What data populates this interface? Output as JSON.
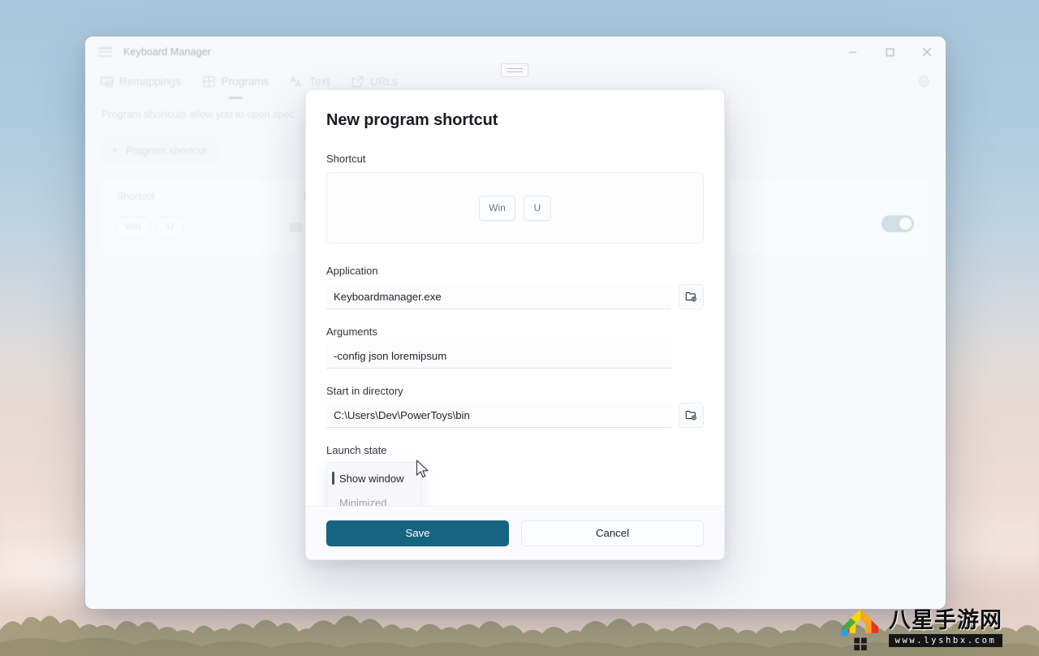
{
  "window": {
    "title": "Keyboard Manager",
    "menu_icon": "hamburger-icon",
    "controls": {
      "minimize": "minimize-icon",
      "maximize": "maximize-icon",
      "close": "close-icon"
    },
    "settings_icon": "gear-icon"
  },
  "tabs": [
    {
      "label": "Remappings",
      "icon": "keyboard-remap-icon",
      "active": false
    },
    {
      "label": "Programs",
      "icon": "grid-apps-icon",
      "active": true
    },
    {
      "label": "Text",
      "icon": "text-aa-icon",
      "active": false
    },
    {
      "label": "URLs",
      "icon": "external-link-icon",
      "active": false
    }
  ],
  "page": {
    "description": "Program shortcuts allow you to open spec",
    "add_button": "Program shortcut",
    "add_icon": "plus-icon",
    "table": {
      "headers": [
        "Shortcut",
        "Pr"
      ],
      "rows": [
        {
          "keys": [
            "Win",
            "U"
          ],
          "app_icon": "app-icon",
          "enabled": true
        }
      ]
    }
  },
  "dialog": {
    "title": "New program shortcut",
    "grabber_icon": "drag-handle-icon",
    "shortcut": {
      "label": "Shortcut",
      "keys": [
        "Win",
        "U"
      ]
    },
    "application": {
      "label": "Application",
      "value": "Keyboardmanager.exe",
      "placeholder": "Application",
      "browse_icon": "folder-browse-icon"
    },
    "arguments": {
      "label": "Arguments",
      "value": "-config json loremipsum",
      "placeholder": "Arguments"
    },
    "start_in_directory": {
      "label": "Start in directory",
      "value": "C:\\Users\\Dev\\PowerToys\\bin",
      "placeholder": "Start in directory",
      "browse_icon": "folder-browse-icon"
    },
    "launch_state": {
      "label": "Launch state",
      "selected": "Show window",
      "options": [
        "Show window",
        "Minimized"
      ]
    },
    "buttons": {
      "save": "Save",
      "cancel": "Cancel"
    }
  },
  "colors": {
    "accent": "#156580",
    "toggle_on": "#9fbcca",
    "dialog_bg": "#ffffff",
    "window_bg": "#f6f7fb",
    "desktop_top": "#a9c6dc",
    "desktop_bottom": "#e3cfc6"
  },
  "watermark": {
    "text_cn": "八星手游网",
    "url": "www.lyshbx.com"
  }
}
